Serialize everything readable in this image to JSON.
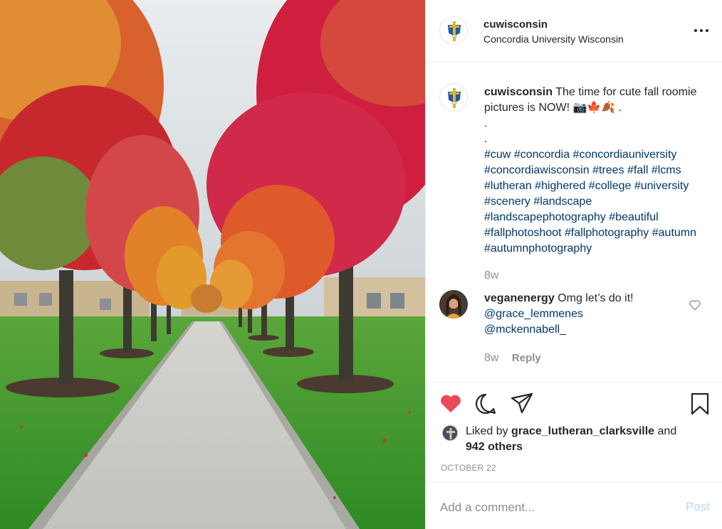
{
  "post": {
    "photo_icon": "fall-tree-lined-walkway-photo",
    "account": {
      "username": "cuwisconsin",
      "subtitle": "Concordia University Wisconsin",
      "avatar_icon": "cross-shield-logo",
      "more_icon": "more-dots-icon"
    },
    "caption": {
      "username": "cuwisconsin",
      "text": "The time for cute fall roomie pictures is NOW! 📷🍁🍂 .",
      "dot1": ".",
      "dot2": ".",
      "hashtags": [
        "#cuw",
        "#concordia",
        "#concordiauniversity",
        "#concordiawisconsin",
        "#trees",
        "#fall",
        "#lcms",
        "#lutheran",
        "#highered",
        "#college",
        "#university",
        "#scenery",
        "#landscape",
        "#landscapephotography",
        "#beautiful",
        "#fallphotoshoot",
        "#fallphotography",
        "#autumn",
        "#autumnphotography"
      ],
      "time": "8w"
    },
    "reply": {
      "username": "veganenergy",
      "text": "Omg let’s do it!",
      "mentions": [
        "@grace_lemmenes",
        "@mckennabell_"
      ],
      "time": "8w",
      "reply_label": "Reply"
    },
    "actions": {
      "liked": true,
      "like_color": "#ed4956",
      "icons": [
        "heart-filled-icon",
        "comment-bubble-icon",
        "share-plane-icon",
        "bookmark-icon"
      ]
    },
    "likes": {
      "prefix": "Liked by",
      "user": "grace_lutheran_clarksville",
      "conjunction": "and",
      "others": "942 others"
    },
    "date": "OCTOBER 22",
    "add_comment": {
      "placeholder": "Add a comment...",
      "post_label": "Post",
      "post_color": "#b3dbff"
    },
    "colors": {
      "link": "#00376b",
      "secondary_text": "#8e8e8e",
      "logo_blue": "#1e5aa8",
      "logo_gold": "#e6b422"
    }
  }
}
